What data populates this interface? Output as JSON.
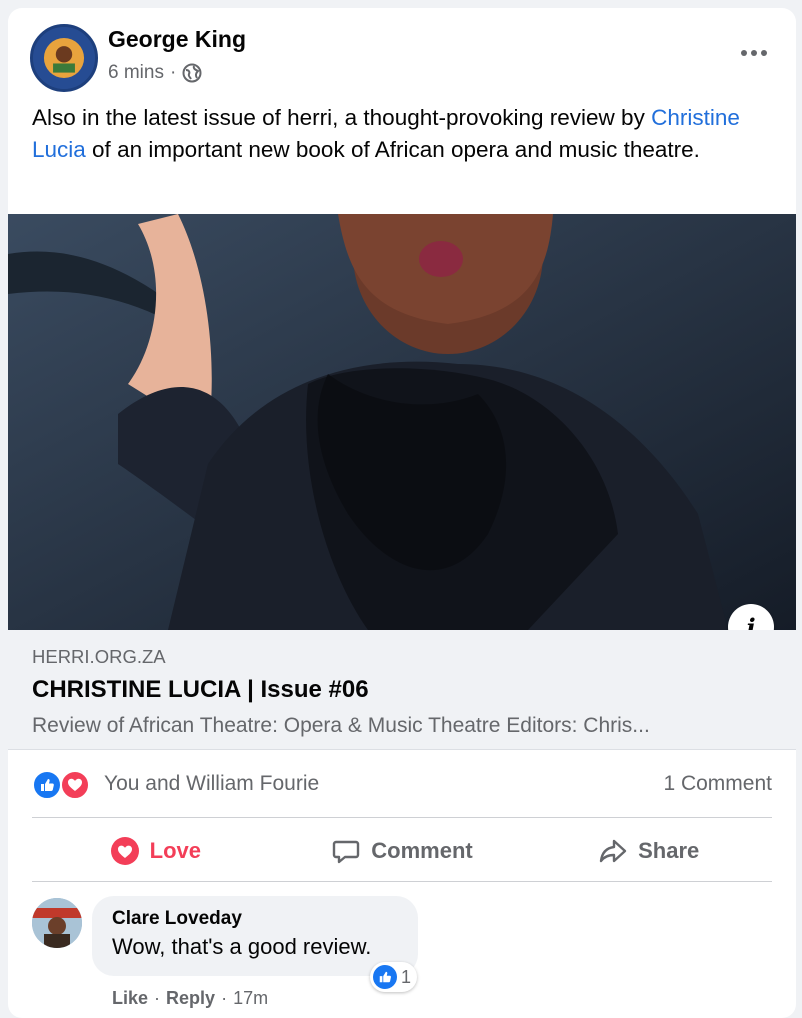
{
  "post": {
    "author": "George King",
    "time": "6 mins",
    "dot": "·",
    "text_before": "Also in the latest issue of herri, a thought-provoking review by ",
    "mention": "Christine Lucia",
    "text_after": " of an important new book of African opera and music theatre."
  },
  "link_preview": {
    "domain": "HERRI.ORG.ZA",
    "title": "CHRISTINE LUCIA | Issue #06",
    "description": "Review of African Theatre: Opera & Music Theatre Editors: Chris..."
  },
  "reactions": {
    "names": "You and William Fourie",
    "comment_count": "1 Comment",
    "types": [
      "like-icon",
      "love-icon"
    ]
  },
  "actions": {
    "love": "Love",
    "comment": "Comment",
    "share": "Share"
  },
  "comment": {
    "author": "Clare Loveday",
    "text": "Wow, that's a good review.",
    "reaction_count": "1",
    "like": "Like",
    "reply": "Reply",
    "time": "17m",
    "sep": "·"
  },
  "colors": {
    "link_blue": "#216fdb",
    "love_red": "#f33e58",
    "like_blue": "#1877f2",
    "secondary_text": "#65676b"
  }
}
